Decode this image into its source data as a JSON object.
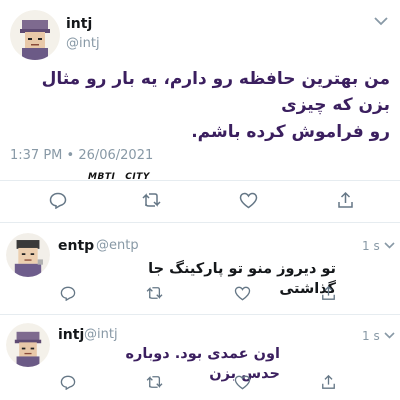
{
  "main_tweet": {
    "name": "intj",
    "handle": "@intj",
    "text_line1": "من بهترین حافظه رو دارم، یه بار رو مثال بزن که چیزی",
    "text_line2": "رو فراموش کرده باشم.",
    "timestamp": "1:37 PM • 26/06/2021",
    "watermark": "MBTI__CITY"
  },
  "replies": [
    {
      "name": "entp",
      "handle": "@entp",
      "time": "1 s",
      "text": "تو دیروز منو تو پارکینگ جا گذاشتی"
    },
    {
      "name": "intj",
      "handle": "@intj",
      "time": "1 s",
      "text": "اون عمدی بود. دوباره حدس بزن"
    }
  ],
  "icons": [
    "reply-icon",
    "retweet-icon",
    "like-icon",
    "share-icon",
    "chevron-down-icon"
  ],
  "colors": {
    "purple_text": "#3b1f5f",
    "muted": "#8899a6",
    "divider": "#e6ecf0"
  }
}
